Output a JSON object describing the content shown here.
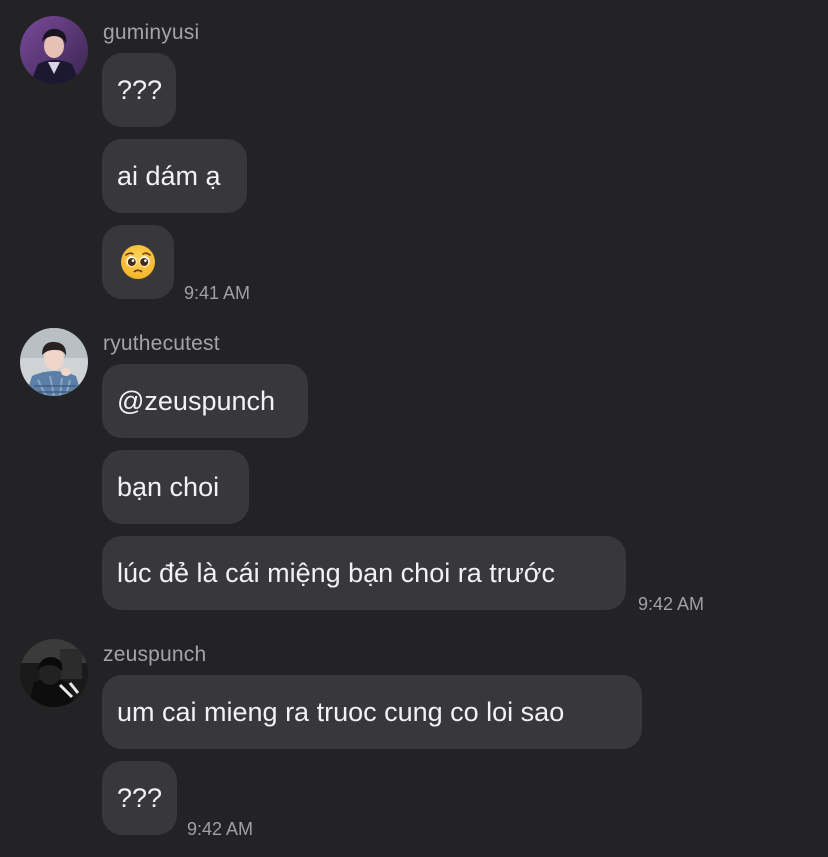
{
  "groups": [
    {
      "sender": "guminyusi",
      "avatar": "profile-photo-man-in-suit",
      "messages": [
        {
          "text": "???"
        },
        {
          "text": "ai dám ạ"
        },
        {
          "emoji": "pleading-face-emoji"
        }
      ],
      "time": "9:41 AM"
    },
    {
      "sender": "ryuthecutest",
      "avatar": "profile-photo-boy-in-plaid",
      "messages": [
        {
          "text": "@zeuspunch"
        },
        {
          "text": "bạn choi"
        },
        {
          "text": "lúc đẻ là cái miệng bạn choi ra trước"
        }
      ],
      "time": "9:42 AM"
    },
    {
      "sender": "zeuspunch",
      "avatar": "profile-photo-dark-monochrome",
      "messages": [
        {
          "text": "um cai mieng ra truoc cung co loi sao"
        },
        {
          "text": "???"
        }
      ],
      "time": "9:42 AM"
    }
  ],
  "colors": {
    "background": "#232325",
    "bubble": "#38383b",
    "sender_text": "#a3a3a8",
    "message_text": "#f2f2f5",
    "timestamp": "#a0a0a5"
  }
}
